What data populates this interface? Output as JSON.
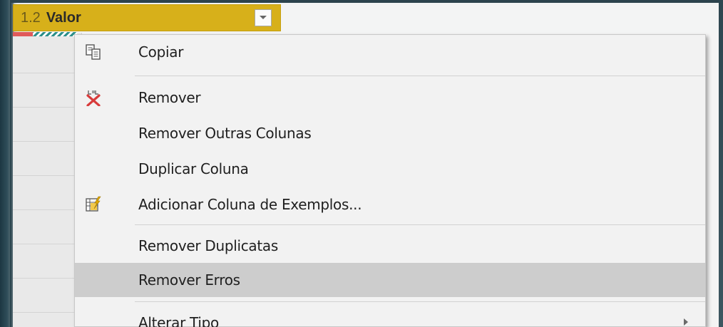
{
  "column_header": {
    "type_label": "1.2",
    "name": "Valor",
    "dropdown_icon": "chevron-down-icon"
  },
  "menu": {
    "items": [
      {
        "id": "copiar",
        "label": "Copiar",
        "icon": "copy-icon"
      },
      {
        "id": "remover",
        "label": "Remover",
        "icon": "remove-column-icon"
      },
      {
        "id": "remover-outras",
        "label": "Remover Outras Colunas",
        "icon": null
      },
      {
        "id": "duplicar",
        "label": "Duplicar Coluna",
        "icon": null
      },
      {
        "id": "adicionar-exemplos",
        "label": "Adicionar Coluna de Exemplos...",
        "icon": "column-from-examples-icon"
      },
      {
        "id": "remover-duplicatas",
        "label": "Remover Duplicatas",
        "icon": null
      },
      {
        "id": "remover-erros",
        "label": "Remover Erros",
        "icon": null,
        "highlighted": true
      },
      {
        "id": "alterar-tipo",
        "label": "Alterar Tipo",
        "icon": null,
        "submenu": true
      }
    ]
  },
  "colors": {
    "header_bg": "#d7b01a",
    "menu_bg": "#f2f2f2",
    "highlight_bg": "#cdcdcd",
    "remove_icon_red": "#d83b3b"
  }
}
